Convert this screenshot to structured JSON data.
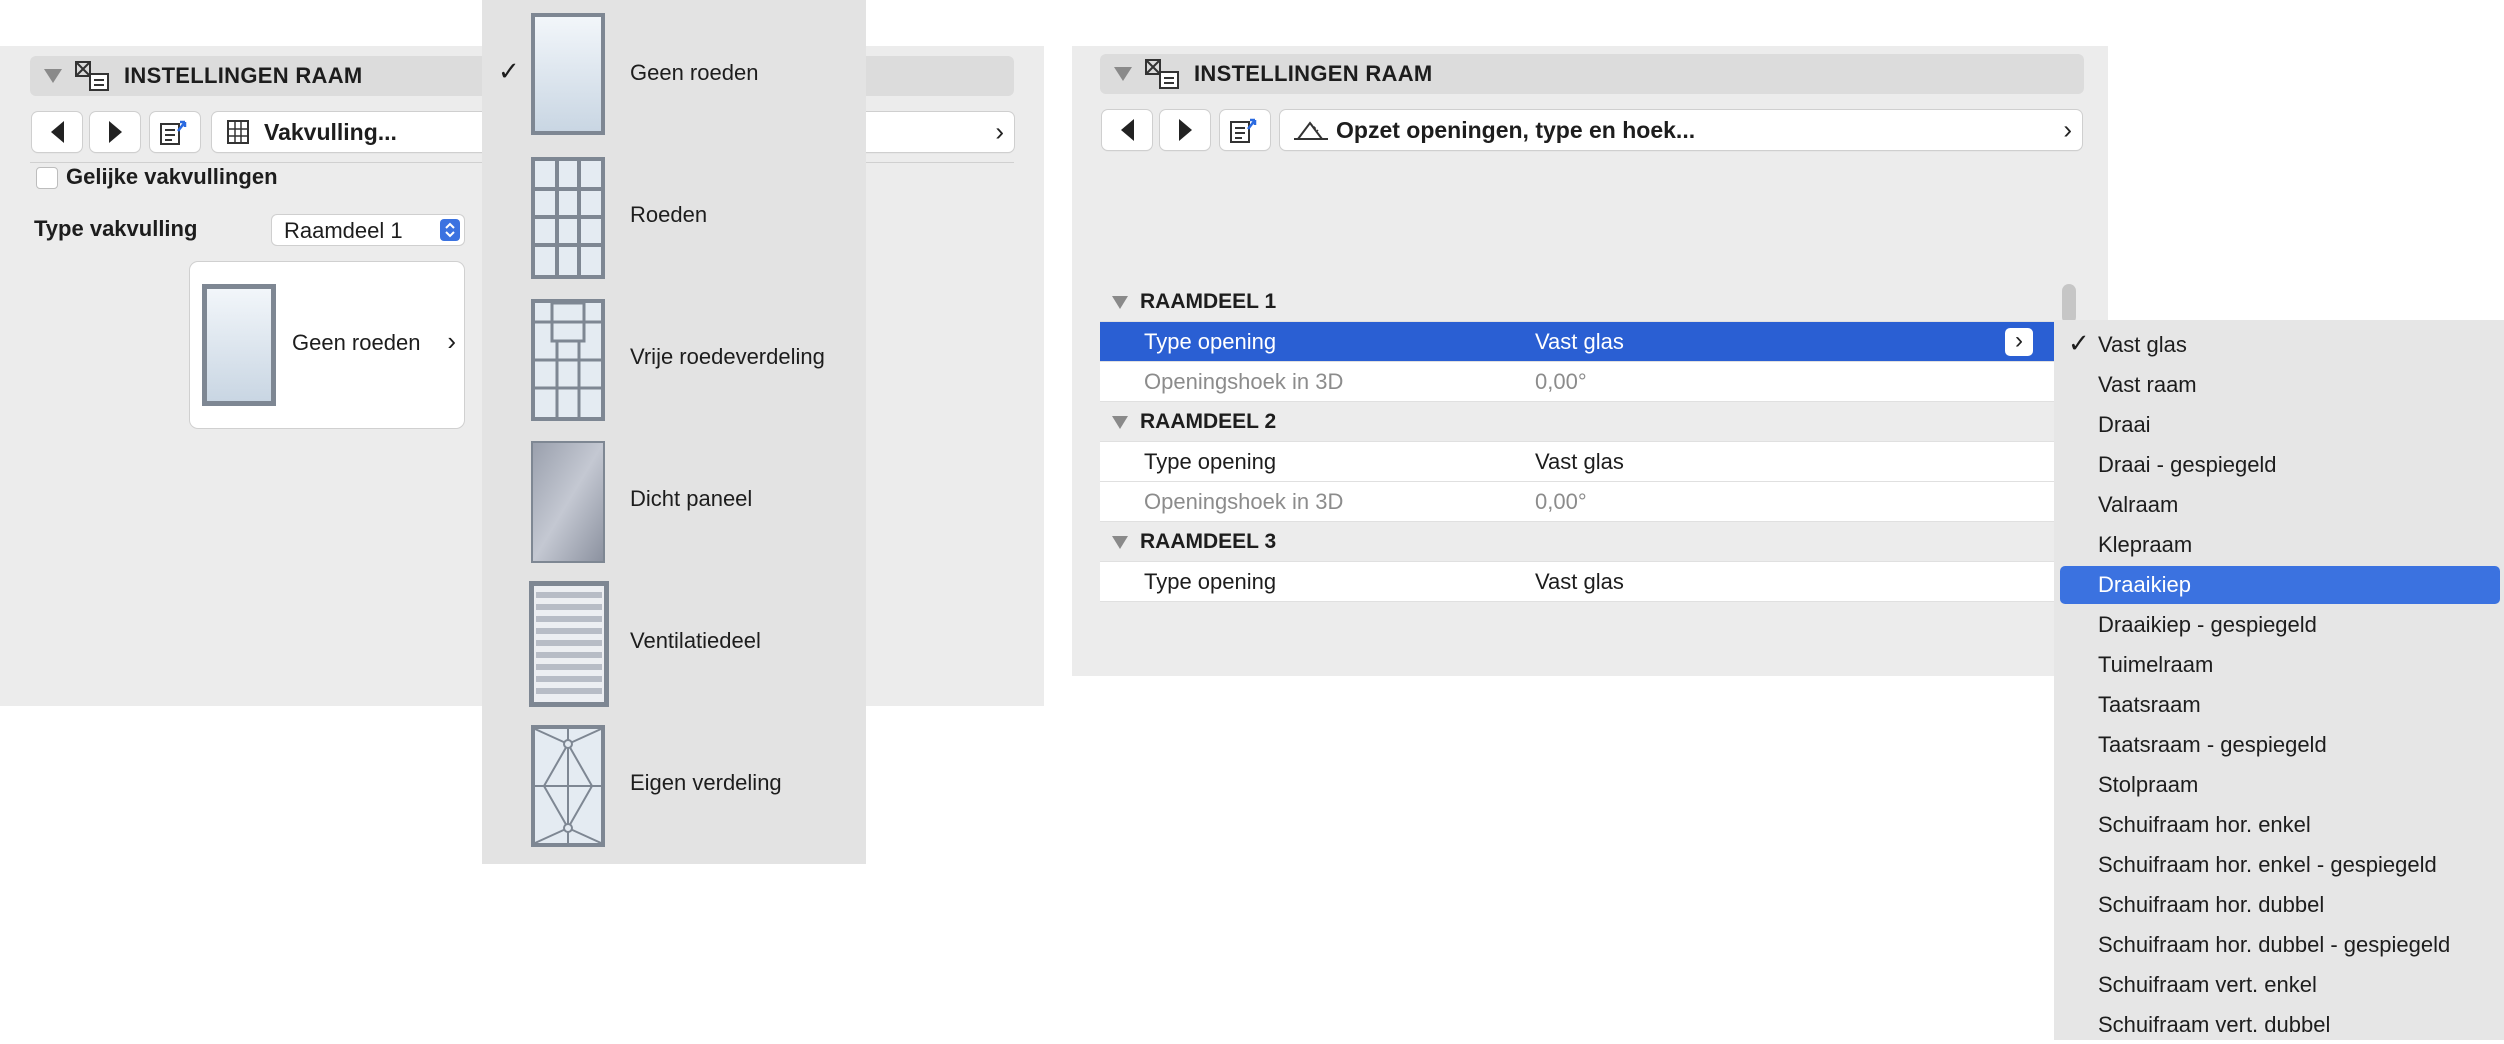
{
  "left_panel": {
    "title": "INSTELLINGEN RAAM",
    "nav_label": "Vakvulling...",
    "checkbox_label": "Gelijke vakvullingen",
    "type_label": "Type vakvulling",
    "type_value": "Raamdeel 1",
    "preview_label": "Geen roeden"
  },
  "fill_menu": {
    "items": [
      {
        "label": "Geen roeden",
        "checked": true,
        "icon": "plain-glass"
      },
      {
        "label": "Roeden",
        "checked": false,
        "icon": "grid-muntins"
      },
      {
        "label": "Vrije roedeverdeling",
        "checked": false,
        "icon": "free-muntins"
      },
      {
        "label": "Dicht paneel",
        "checked": false,
        "icon": "solid-panel"
      },
      {
        "label": "Ventilatiedeel",
        "checked": false,
        "icon": "louvre"
      },
      {
        "label": "Eigen verdeling",
        "checked": false,
        "icon": "diamond-pattern"
      }
    ]
  },
  "right_panel": {
    "title": "INSTELLINGEN RAAM",
    "nav_label": "Opzet openingen, type en hoek...",
    "groups": [
      {
        "name": "RAAMDEEL 1",
        "rows": [
          {
            "label": "Type opening",
            "value": "Vast glas",
            "selected": true
          },
          {
            "label": "Openingshoek in 3D",
            "value": "0,00°",
            "muted": true
          }
        ]
      },
      {
        "name": "RAAMDEEL 2",
        "rows": [
          {
            "label": "Type opening",
            "value": "Vast glas"
          },
          {
            "label": "Openingshoek in 3D",
            "value": "0,00°",
            "muted": true
          }
        ]
      },
      {
        "name": "RAAMDEEL 3",
        "rows": [
          {
            "label": "Type opening",
            "value": "Vast glas"
          }
        ]
      }
    ]
  },
  "opening_menu": {
    "items": [
      "Vast glas",
      "Vast raam",
      "Draai",
      "Draai - gespiegeld",
      "Valraam",
      "Klepraam",
      "Draaikiep",
      "Draaikiep - gespiegeld",
      "Tuimelraam",
      "Taatsraam",
      "Taatsraam - gespiegeld",
      "Stolpraam",
      "Schuifraam hor. enkel",
      "Schuifraam hor. enkel - gespiegeld",
      "Schuifraam hor. dubbel",
      "Schuifraam hor. dubbel - gespiegeld",
      "Schuifraam vert. enkel",
      "Schuifraam vert. dubbel"
    ],
    "checked": "Vast glas",
    "highlighted": "Draaikiep"
  },
  "colors": {
    "accent": "#2a5fd3",
    "highlight": "#3b72e0"
  }
}
